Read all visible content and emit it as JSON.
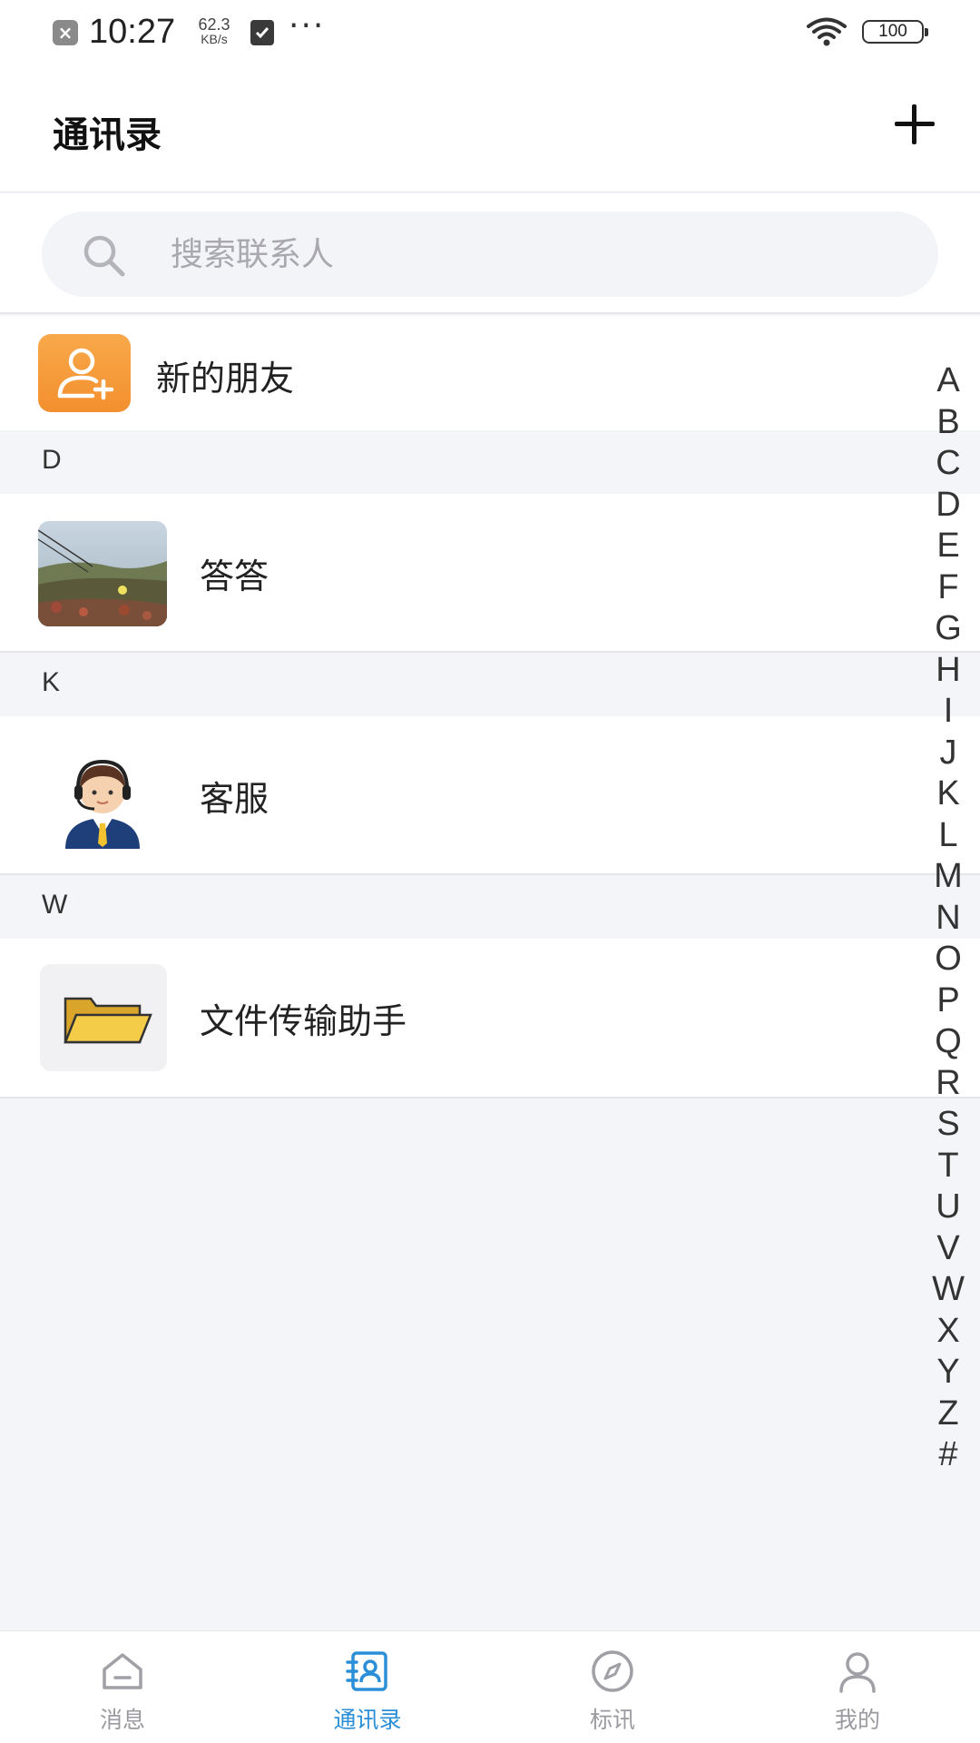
{
  "status_bar": {
    "time": "10:27",
    "net_speed_value": "62.3",
    "net_speed_unit": "KB/s",
    "more": "···",
    "battery": "100"
  },
  "header": {
    "title": "通讯录",
    "add_icon": "plus-icon"
  },
  "search": {
    "placeholder": "搜索联系人",
    "value": ""
  },
  "new_friends": {
    "label": "新的朋友",
    "icon": "add-user-icon",
    "icon_color": "#f59a35"
  },
  "sections": [
    {
      "letter": "D",
      "contacts": [
        {
          "name": "答答",
          "avatar": "landscape-photo"
        }
      ]
    },
    {
      "letter": "K",
      "contacts": [
        {
          "name": "客服",
          "avatar": "customer-service-agent"
        }
      ]
    },
    {
      "letter": "W",
      "contacts": [
        {
          "name": "文件传输助手",
          "avatar": "folder-icon"
        }
      ]
    }
  ],
  "alphabet_index": [
    "A",
    "B",
    "C",
    "D",
    "E",
    "F",
    "G",
    "H",
    "I",
    "J",
    "K",
    "L",
    "M",
    "N",
    "O",
    "P",
    "Q",
    "R",
    "S",
    "T",
    "U",
    "V",
    "W",
    "X",
    "Y",
    "Z",
    "#"
  ],
  "bottom_nav": {
    "active_color": "#2b8fd8",
    "items": [
      {
        "label": "消息",
        "icon": "message-icon",
        "active": false
      },
      {
        "label": "通讯录",
        "icon": "contacts-icon",
        "active": true
      },
      {
        "label": "标讯",
        "icon": "compass-icon",
        "active": false
      },
      {
        "label": "我的",
        "icon": "profile-icon",
        "active": false
      }
    ]
  }
}
